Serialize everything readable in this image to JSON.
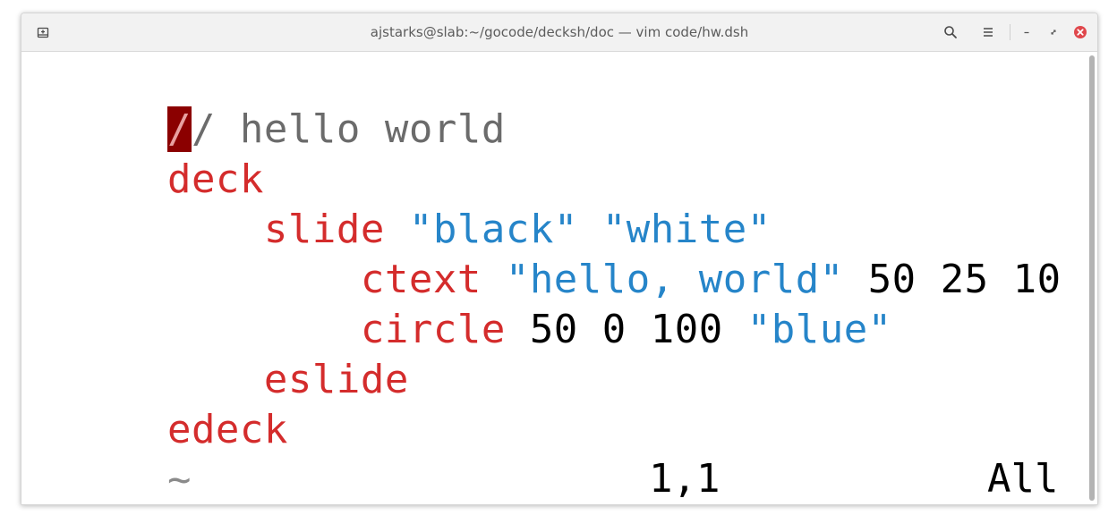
{
  "window": {
    "title": "ajstarks@slab:~/gocode/decksh/doc — vim code/hw.dsh"
  },
  "titlebar_icons": {
    "new_tab": "new-tab-icon",
    "search": "search-icon",
    "menu": "hamburger-menu-icon",
    "minimize": "minimize-icon",
    "maximize": "maximize-icon",
    "close": "close-icon"
  },
  "editor": {
    "lines": [
      [
        {
          "text": "/",
          "type": "cursor"
        },
        {
          "text": "/ hello world",
          "type": "comment"
        }
      ],
      [
        {
          "text": "deck",
          "type": "keyword"
        }
      ],
      [
        {
          "text": "    ",
          "type": "plain"
        },
        {
          "text": "slide",
          "type": "keyword"
        },
        {
          "text": " ",
          "type": "plain"
        },
        {
          "text": "\"black\"",
          "type": "string"
        },
        {
          "text": " ",
          "type": "plain"
        },
        {
          "text": "\"white\"",
          "type": "string"
        }
      ],
      [
        {
          "text": "        ",
          "type": "plain"
        },
        {
          "text": "ctext",
          "type": "keyword"
        },
        {
          "text": " ",
          "type": "plain"
        },
        {
          "text": "\"hello, world\"",
          "type": "string"
        },
        {
          "text": " 50 25 10",
          "type": "number"
        }
      ],
      [
        {
          "text": "        ",
          "type": "plain"
        },
        {
          "text": "circle",
          "type": "keyword"
        },
        {
          "text": " 50 0 100 ",
          "type": "number"
        },
        {
          "text": "\"blue\"",
          "type": "string"
        }
      ],
      [
        {
          "text": "    ",
          "type": "plain"
        },
        {
          "text": "eslide",
          "type": "keyword"
        }
      ],
      [
        {
          "text": "edeck",
          "type": "keyword"
        }
      ],
      [
        {
          "text": "~",
          "type": "tilde"
        }
      ]
    ]
  },
  "statusline": {
    "position": "1,1",
    "scroll": "All"
  },
  "colors": {
    "keyword": "#d42c2c",
    "string": "#2685c9",
    "number": "#000000",
    "comment": "#6b6b6b",
    "cursor_bg": "#8b0000",
    "close_button": "#e0474c"
  }
}
